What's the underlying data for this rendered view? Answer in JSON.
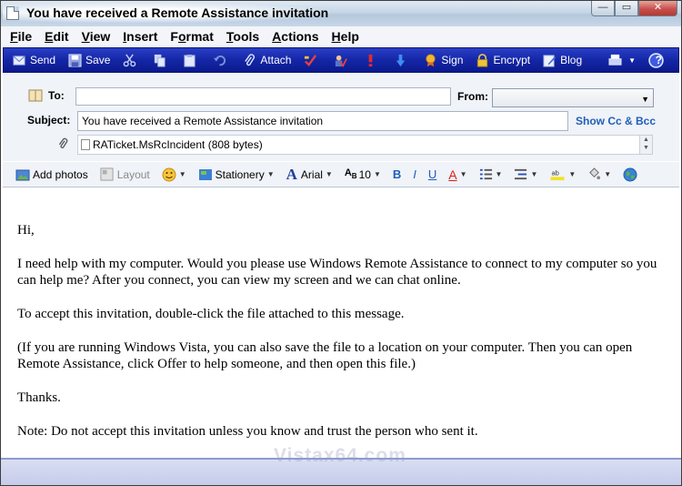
{
  "window": {
    "title": "You have received a Remote Assistance invitation",
    "minimize": "—",
    "maximize": "▭",
    "close": "✕"
  },
  "menu": [
    {
      "label_u": "F",
      "label_rest": "ile"
    },
    {
      "label_u": "E",
      "label_rest": "dit"
    },
    {
      "label_u": "V",
      "label_rest": "iew"
    },
    {
      "label_u": "I",
      "label_rest": "nsert"
    },
    {
      "label_pre": "F",
      "label_u": "o",
      "label_rest": "rmat"
    },
    {
      "label_u": "T",
      "label_rest": "ools"
    },
    {
      "label_u": "A",
      "label_rest": "ctions"
    },
    {
      "label_u": "H",
      "label_rest": "elp"
    }
  ],
  "toolbar": {
    "send": "Send",
    "save": "Save",
    "attach": "Attach",
    "sign": "Sign",
    "encrypt": "Encrypt",
    "blog": "Blog",
    "help_glyph": "?"
  },
  "header": {
    "to_label": "To:",
    "to_value": "",
    "from_label": "From:",
    "subject_label": "Subject:",
    "subject_value": "You have received a Remote Assistance invitation",
    "show_cc": "Show Cc & Bcc",
    "attachment": "RATicket.MsRcIncident (808 bytes)"
  },
  "format": {
    "add_photos": "Add photos",
    "layout": "Layout",
    "stationery": "Stationery",
    "font": "Arial",
    "size": "10",
    "bold": "B",
    "italic": "I",
    "underline": "U",
    "font_color": "A"
  },
  "body": {
    "greeting": "Hi,",
    "p1": "I need help with my computer. Would you please use Windows Remote Assistance to connect to my computer so you can help me? After you connect, you can view my screen and we can chat online.",
    "p2": "To accept this invitation, double-click the file attached to this message.",
    "p3": "(If you are running Windows Vista, you can also save the file to a location on your computer. Then you can open Remote Assistance, click Offer to help someone, and then open this file.)",
    "p4": "Thanks.",
    "p5": "Note:  Do not accept this invitation unless you know and trust the person who sent it."
  },
  "watermark": "Vistax64.com",
  "colors": {
    "toolbar_blue": "#1426a6",
    "link_blue": "#1f5fb8",
    "accent_red": "#d62020"
  }
}
